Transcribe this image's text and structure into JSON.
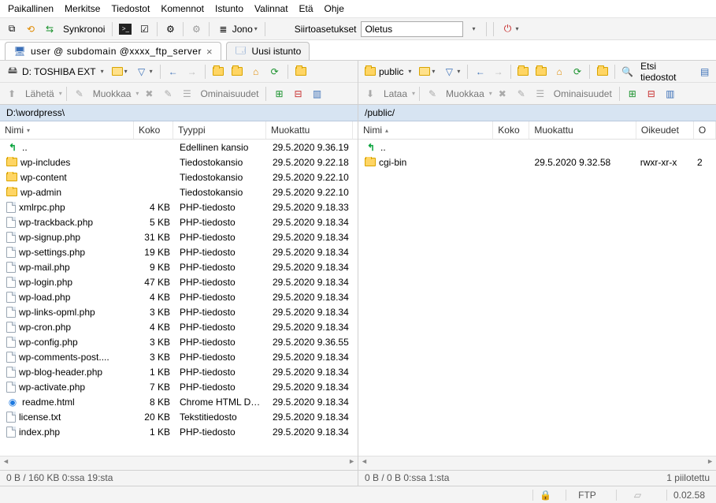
{
  "menu": [
    "Paikallinen",
    "Merkitse",
    "Tiedostot",
    "Komennot",
    "Istunto",
    "Valinnat",
    "Etä",
    "Ohje"
  ],
  "main_toolbar": {
    "sync_label": "Synkronoi",
    "queue_label": "Jono",
    "transfer_label": "Siirtoasetukset",
    "preset_value": "Oletus"
  },
  "tabs": {
    "session_title": "user @    subdomain  @xxxx_ftp_server",
    "new_session": "Uusi istunto"
  },
  "local": {
    "drive": "D: TOSHIBA EXT",
    "action_send": "Lähetä",
    "action_edit": "Muokkaa",
    "action_props": "Ominaisuudet",
    "path": "D:\\wordpress\\",
    "columns": {
      "name": "Nimi",
      "size": "Koko",
      "type": "Tyyppi",
      "mod": "Muokattu"
    },
    "files": [
      {
        "icon": "up",
        "name": "..",
        "size": "",
        "type": "Edellinen kansio",
        "mod": "29.5.2020  9.36.19"
      },
      {
        "icon": "folder",
        "name": "wp-includes",
        "size": "",
        "type": "Tiedostokansio",
        "mod": "29.5.2020  9.22.18"
      },
      {
        "icon": "folder",
        "name": "wp-content",
        "size": "",
        "type": "Tiedostokansio",
        "mod": "29.5.2020  9.22.10"
      },
      {
        "icon": "folder",
        "name": "wp-admin",
        "size": "",
        "type": "Tiedostokansio",
        "mod": "29.5.2020  9.22.10"
      },
      {
        "icon": "php",
        "name": "xmlrpc.php",
        "size": "4 KB",
        "type": "PHP-tiedosto",
        "mod": "29.5.2020  9.18.33"
      },
      {
        "icon": "php",
        "name": "wp-trackback.php",
        "size": "5 KB",
        "type": "PHP-tiedosto",
        "mod": "29.5.2020  9.18.34"
      },
      {
        "icon": "php",
        "name": "wp-signup.php",
        "size": "31 KB",
        "type": "PHP-tiedosto",
        "mod": "29.5.2020  9.18.34"
      },
      {
        "icon": "php",
        "name": "wp-settings.php",
        "size": "19 KB",
        "type": "PHP-tiedosto",
        "mod": "29.5.2020  9.18.34"
      },
      {
        "icon": "php",
        "name": "wp-mail.php",
        "size": "9 KB",
        "type": "PHP-tiedosto",
        "mod": "29.5.2020  9.18.34"
      },
      {
        "icon": "php",
        "name": "wp-login.php",
        "size": "47 KB",
        "type": "PHP-tiedosto",
        "mod": "29.5.2020  9.18.34"
      },
      {
        "icon": "php",
        "name": "wp-load.php",
        "size": "4 KB",
        "type": "PHP-tiedosto",
        "mod": "29.5.2020  9.18.34"
      },
      {
        "icon": "php",
        "name": "wp-links-opml.php",
        "size": "3 KB",
        "type": "PHP-tiedosto",
        "mod": "29.5.2020  9.18.34"
      },
      {
        "icon": "php",
        "name": "wp-cron.php",
        "size": "4 KB",
        "type": "PHP-tiedosto",
        "mod": "29.5.2020  9.18.34"
      },
      {
        "icon": "php",
        "name": "wp-config.php",
        "size": "3 KB",
        "type": "PHP-tiedosto",
        "mod": "29.5.2020  9.36.55"
      },
      {
        "icon": "php",
        "name": "wp-comments-post....",
        "size": "3 KB",
        "type": "PHP-tiedosto",
        "mod": "29.5.2020  9.18.34"
      },
      {
        "icon": "php",
        "name": "wp-blog-header.php",
        "size": "1 KB",
        "type": "PHP-tiedosto",
        "mod": "29.5.2020  9.18.34"
      },
      {
        "icon": "php",
        "name": "wp-activate.php",
        "size": "7 KB",
        "type": "PHP-tiedosto",
        "mod": "29.5.2020  9.18.34"
      },
      {
        "icon": "html",
        "name": "readme.html",
        "size": "8 KB",
        "type": "Chrome HTML Do...",
        "mod": "29.5.2020  9.18.34"
      },
      {
        "icon": "txt",
        "name": "license.txt",
        "size": "20 KB",
        "type": "Tekstitiedosto",
        "mod": "29.5.2020  9.18.34"
      },
      {
        "icon": "php",
        "name": "index.php",
        "size": "1 KB",
        "type": "PHP-tiedosto",
        "mod": "29.5.2020  9.18.34"
      }
    ],
    "status": "0 B / 160 KB 0:ssa 19:sta"
  },
  "remote": {
    "dir": "public",
    "action_get": "Lataa",
    "action_edit": "Muokkaa",
    "action_props": "Ominaisuudet",
    "find": "Etsi tiedostot",
    "path": "/public/",
    "columns": {
      "name": "Nimi",
      "size": "Koko",
      "mod": "Muokattu",
      "perm": "Oikeudet",
      "own": "O"
    },
    "files": [
      {
        "icon": "up",
        "name": "..",
        "size": "",
        "mod": "",
        "perm": "",
        "own": ""
      },
      {
        "icon": "folder",
        "name": "cgi-bin",
        "size": "",
        "mod": "29.5.2020 9.32.58",
        "perm": "rwxr-xr-x",
        "own": "2"
      }
    ],
    "status": "0 B / 0 B 0:ssa 1:sta",
    "hidden": "1 piilotettu"
  },
  "status": {
    "protocol": "FTP",
    "elapsed": "0.02.58"
  }
}
